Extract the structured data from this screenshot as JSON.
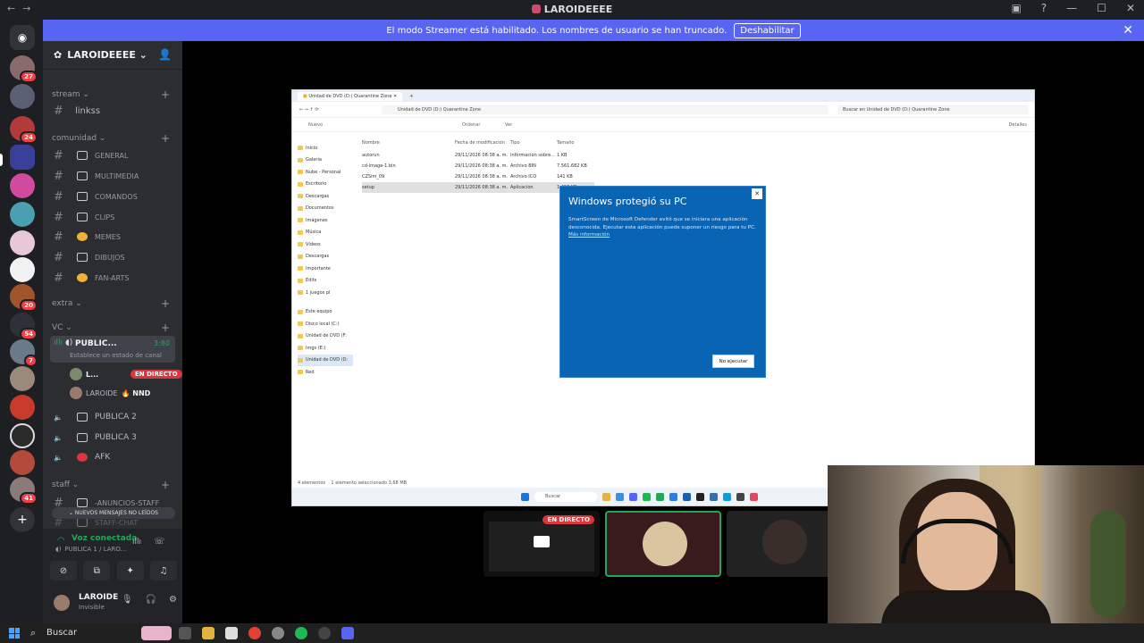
{
  "app_title": "LAROIDEEEE",
  "streamer_banner": {
    "message": "El modo Streamer está habilitado. Los nombres de usuario se han truncado.",
    "button": "Deshabilitar"
  },
  "server_rail": {
    "badges": [
      "27",
      "24",
      "20",
      "54",
      "7",
      "41"
    ]
  },
  "sidebar": {
    "server_name": "LAROIDEEEE ⌄",
    "categories": {
      "stream": "stream ⌄",
      "comunidad": "comunidad ⌄",
      "extra": "extra ⌄",
      "vc": "VC ⌄",
      "staff": "staff ⌄"
    },
    "channels": {
      "linkss": "linkss",
      "general": "GENERAL",
      "multimedia": "MULTIMEDIA",
      "comandos": "COMANDOS",
      "clips": "CLIPS",
      "memes": "MEMES",
      "dibujos": "DIBUJOS",
      "fanarts": "FAN-ARTS",
      "publica2": "PUBLICA 2",
      "publica3": "PUBLICA 3",
      "afk": "AFK",
      "anuncios_staff": "-ANUNCIOS-STAFF",
      "staff_chat": "STAFF-CHAT"
    },
    "active_voice": {
      "name": "PUBLIC...",
      "time": "3:80",
      "status": "Establece un estado de canal",
      "user1": "L...",
      "user1_tag": "EN DIRECTO",
      "user2": "LAROIDE",
      "user2_tag": "🔥 NND"
    },
    "unread_pill": "⌄ NUEVOS MENSAJES NO LEÍDOS"
  },
  "voice_panel": {
    "connected": "Voz conectada",
    "channel": "PUBLICA 1 / LARO...",
    "username": "LAROIDE",
    "status": "Invisible"
  },
  "explorer": {
    "tab_title": "Unidad de DVD (D:) Quarantine Zone",
    "address": "Unidad de DVD (D:) Quarantine Zone",
    "search_placeholder": "Buscar en Unidad de DVD (D:) Quarantine Zone",
    "cmd_new": "Nuevo",
    "cmd_sort": "Ordenar",
    "cmd_view": "Ver",
    "cmd_details": "Detalles",
    "nav_items": [
      "Inicio",
      "Galería",
      "Nube - Personal",
      "Escritorio",
      "Descargas",
      "Documentos",
      "Imágenes",
      "Música",
      "Vídeos",
      "Descargas",
      "Importante",
      "Edits",
      "1 juegos pl",
      "Este equipo",
      "Disco local (C:)",
      "Unidad de DVD (F:",
      "Imgs (E:)",
      "Unidad de DVD (D:",
      "Red"
    ],
    "columns": [
      "Nombre",
      "Fecha de modificación",
      "Tipo",
      "Tamaño"
    ],
    "files": [
      {
        "name": "autorun",
        "date": "29/11/2026 08:38 a. m.",
        "type": "Información sobre...",
        "size": "1 KB"
      },
      {
        "name": "cd-image-1.bin",
        "date": "29/11/2026 08:38 a. m.",
        "type": "Archivo BIN",
        "size": "7.561.682 KB"
      },
      {
        "name": "CZSim_09",
        "date": "29/11/2026 08:38 a. m.",
        "type": "Archivo ICO",
        "size": "141 KB"
      },
      {
        "name": "setup",
        "date": "29/11/2026 08:38 a. m.",
        "type": "Aplicación",
        "size": "1.456 KB"
      }
    ],
    "status_items": "4 elementos",
    "status_selected": "1 elemento seleccionado  3,68 MB",
    "taskbar_search": "Buscar"
  },
  "smartscreen": {
    "title": "Windows protegió su PC",
    "body": "SmartScreen de Microsoft Defender evitó que se iniciara una aplicación desconocida. Ejecutar esta aplicación puede suponer un riesgo para tu PC.",
    "more_info": "Más información",
    "button": "No ejecutar"
  },
  "stream_tiles": {
    "live_tag": "EN DIRECTO"
  },
  "win_taskbar": {
    "search": "Buscar"
  }
}
